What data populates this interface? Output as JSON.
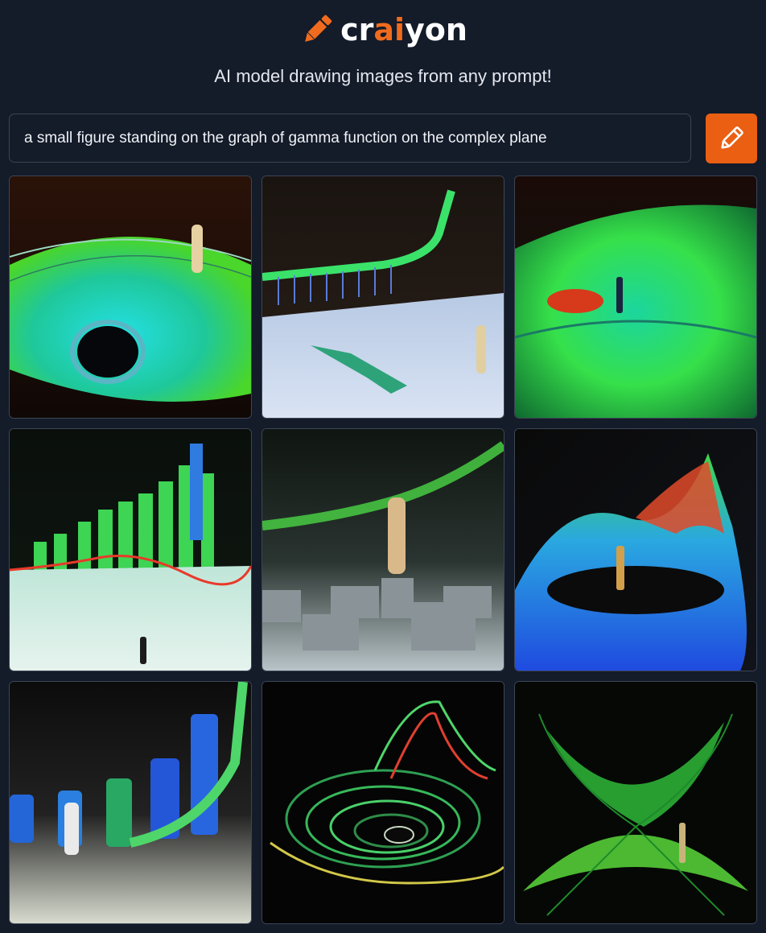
{
  "brand": {
    "logo_prefix": "cr",
    "logo_mid": "ai",
    "logo_suffix": "yon",
    "logo_icon": "pencil-icon",
    "tagline": "AI model drawing images from any prompt!"
  },
  "prompt": {
    "value": "a small figure standing on the graph of gamma function on the complex plane",
    "placeholder": ""
  },
  "draw_button": {
    "icon": "pencil-icon"
  },
  "colors": {
    "background": "#141b29",
    "accent": "#ea5f12",
    "border": "#3d4656"
  },
  "results": [
    {
      "id": "result-1"
    },
    {
      "id": "result-2"
    },
    {
      "id": "result-3"
    },
    {
      "id": "result-4"
    },
    {
      "id": "result-5"
    },
    {
      "id": "result-6"
    },
    {
      "id": "result-7"
    },
    {
      "id": "result-8"
    },
    {
      "id": "result-9"
    }
  ]
}
